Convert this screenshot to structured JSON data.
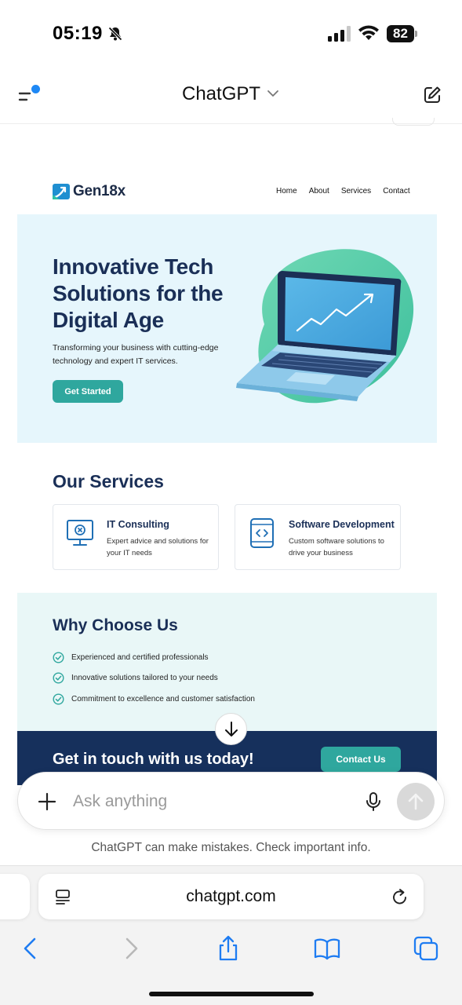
{
  "status_bar": {
    "time": "05:19",
    "battery": "82",
    "icons": [
      "bell-slash-icon",
      "signal-icon",
      "wifi-icon",
      "battery-icon"
    ]
  },
  "header": {
    "title": "ChatGPT",
    "icons": [
      "menu-icon",
      "chevron-down-icon",
      "new-chat-icon"
    ],
    "accent": "#1e88f5"
  },
  "site": {
    "logo_text": "Gen18x",
    "nav": [
      "Home",
      "About",
      "Services",
      "Contact"
    ],
    "hero": {
      "title": "Innovative Tech Solutions for the Digital Age",
      "subtitle": "Transforming your business with cutting-edge technology and expert IT services.",
      "button": "Get Started"
    },
    "services": {
      "title": "Our Services",
      "items": [
        {
          "name": "IT Consulting",
          "desc": "Expert advice and solutions for your IT needs",
          "icon": "monitor-gear-icon"
        },
        {
          "name": "Software Development",
          "desc": "Custom software solutions to drive your business",
          "icon": "code-phone-icon"
        }
      ]
    },
    "why": {
      "title": "Why Choose Us",
      "items": [
        "Experienced and certified professionals",
        "Innovative solutions tailored to your needs",
        "Commitment to excellence and customer satisfaction"
      ]
    },
    "cta": {
      "title": "Get in touch with us today!",
      "button": "Contact Us"
    },
    "colors": {
      "navy": "#1a2f57",
      "teal": "#2fa79e",
      "hero_bg": "#e6f6fc",
      "why_bg": "#e9f7f7",
      "cta_bg": "#16305c"
    }
  },
  "composer": {
    "placeholder": "Ask anything",
    "icons": [
      "plus-icon",
      "microphone-icon",
      "arrow-up-icon"
    ]
  },
  "disclaimer": "ChatGPT can make mistakes. Check important info.",
  "browser": {
    "url": "chatgpt.com",
    "toolbar": [
      "back-icon",
      "forward-icon",
      "share-icon",
      "bookmarks-icon",
      "tabs-icon"
    ]
  }
}
